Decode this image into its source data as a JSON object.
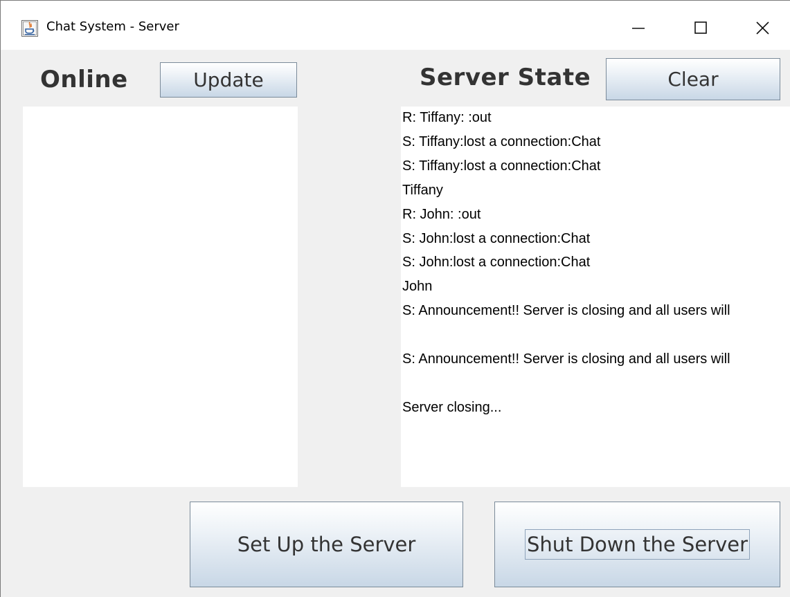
{
  "window": {
    "title": "Chat System - Server",
    "controls": {
      "minimize": "minimize-icon",
      "maximize": "maximize-icon",
      "close": "close-icon"
    }
  },
  "online": {
    "heading": "Online",
    "update_label": "Update",
    "users": []
  },
  "server_state": {
    "heading": "Server State",
    "clear_label": "Clear",
    "log": [
      "R: Tiffany: :out",
      "S: Tiffany:lost a connection:Chat",
      "S: Tiffany:lost a connection:Chat",
      "Tiffany",
      "R: John: :out",
      "S: John:lost a connection:Chat",
      "S: John:lost a connection:Chat",
      "John",
      "S: Announcement!! Server is closing and all users will",
      "",
      "S: Announcement!! Server is closing and all users will",
      "",
      "Server closing..."
    ]
  },
  "actions": {
    "setup_label": "Set Up the Server",
    "shutdown_label": "Shut Down the Server"
  },
  "colors": {
    "window_bg": "#f0f0f0",
    "titlebar_bg": "#ffffff",
    "heading_text": "#333333",
    "button_border": "#7a8a99",
    "button_gradient_top": "#ffffff",
    "button_gradient_bottom": "#c8d7e6"
  }
}
